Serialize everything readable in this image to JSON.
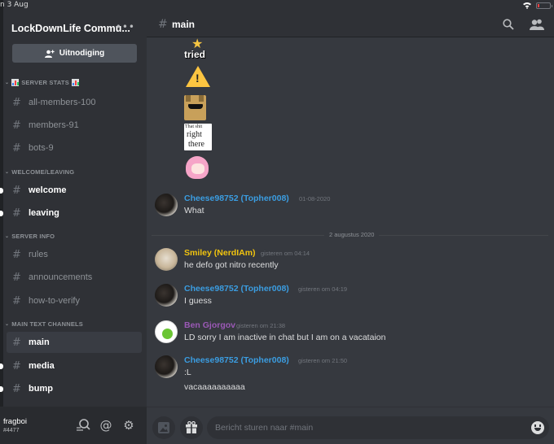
{
  "status_bar": {
    "time": "n 3 Aug"
  },
  "guild": {
    "name": "LockDownLife Commu...",
    "more_icon": "ellipsis-icon",
    "invite_label": "Uitnodiging"
  },
  "categories": [
    {
      "label": "SERVER STATS",
      "emoji": "bar-chart-emoji",
      "channels": [
        {
          "name": "all-members-100",
          "state": "normal"
        },
        {
          "name": "members-91",
          "state": "normal"
        },
        {
          "name": "bots-9",
          "state": "normal"
        }
      ]
    },
    {
      "label": "WELCOME/LEAVING",
      "channels": [
        {
          "name": "welcome",
          "state": "unread"
        },
        {
          "name": "leaving",
          "state": "unread"
        }
      ]
    },
    {
      "label": "SERVER INFO",
      "channels": [
        {
          "name": "rules",
          "state": "normal"
        },
        {
          "name": "announcements",
          "state": "normal"
        },
        {
          "name": "how-to-verify",
          "state": "normal"
        }
      ]
    },
    {
      "label": "MAIN TEXT CHANNELS",
      "channels": [
        {
          "name": "main",
          "state": "active"
        },
        {
          "name": "media",
          "state": "unread"
        },
        {
          "name": "bump",
          "state": "unread"
        }
      ]
    }
  ],
  "user_panel": {
    "username": "fragboi",
    "discriminator": "#4477",
    "icons": [
      "search-friends-icon",
      "mention-icon",
      "settings-gear-icon"
    ]
  },
  "channel_header": {
    "hash": "#",
    "title": "main",
    "icons": [
      "search-icon",
      "members-icon"
    ]
  },
  "stickers": [
    {
      "name": "you-tried-sticker",
      "text": "tried"
    },
    {
      "name": "warning-sticker",
      "text": "!"
    },
    {
      "name": "doge-sunglasses-sticker"
    },
    {
      "name": "that-shit-right-there-sticker",
      "lines": [
        "That shit",
        "right",
        "there"
      ]
    },
    {
      "name": "anime-girl-sticker"
    }
  ],
  "date_divider": "2 augustus 2020",
  "messages": [
    {
      "author": "Cheese98752 (Topher008)",
      "color": "#3b9de1",
      "time": "01-08-2020",
      "lines": [
        "What"
      ],
      "avatar": "cheese"
    },
    {
      "author": "Smiley (NerdIAm)",
      "color": "#f1c40f",
      "time": "gisteren om 04:14",
      "lines": [
        "he defo got nitro recently"
      ],
      "avatar": "smiley"
    },
    {
      "author": "Cheese98752 (Topher008)",
      "color": "#3b9de1",
      "time": "gisteren om 04:19",
      "lines": [
        "I guess"
      ],
      "avatar": "cheese"
    },
    {
      "author": "Ben Gjorgov",
      "color": "#9b59b6",
      "time": "gisteren om 21:38",
      "lines": [
        "LD sorry I am inactive in chat but I am on a vacataion"
      ],
      "avatar": "ben"
    },
    {
      "author": "Cheese98752 (Topher008)",
      "color": "#3b9de1",
      "time": "gisteren om 21:50",
      "lines": [
        ":L",
        "vacaaaaaaaaaa"
      ],
      "avatar": "cheese"
    }
  ],
  "composer": {
    "placeholder": "Bericht sturen naar #main",
    "buttons": [
      "image-upload-icon",
      "gift-icon",
      "emoji-icon"
    ]
  },
  "colors": {
    "accent_link": "#3b9de1",
    "background_main": "#36393f",
    "background_sidebar": "#2f3136"
  }
}
